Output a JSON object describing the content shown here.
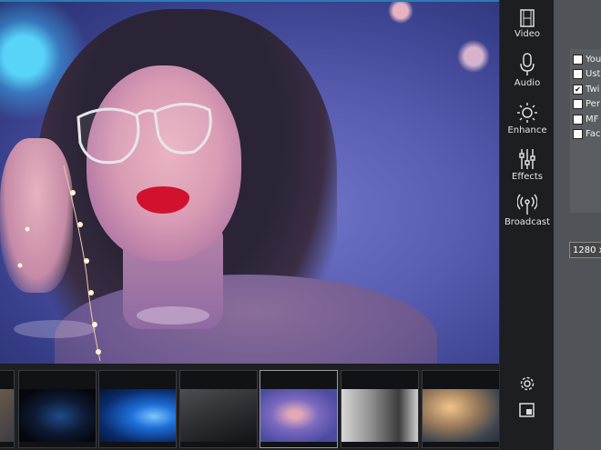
{
  "toolbar": {
    "items": [
      {
        "label": "Video",
        "icon": "film-icon"
      },
      {
        "label": "Audio",
        "icon": "microphone-icon"
      },
      {
        "label": "Enhance",
        "icon": "sun-icon"
      },
      {
        "label": "Effects",
        "icon": "sliders-icon"
      },
      {
        "label": "Broadcast",
        "icon": "broadcast-icon"
      }
    ],
    "bottom": [
      {
        "icon": "gear-icon"
      },
      {
        "icon": "picture-in-picture-icon"
      }
    ]
  },
  "panel": {
    "services": [
      {
        "label": "You",
        "checked": false
      },
      {
        "label": "Ust",
        "checked": false
      },
      {
        "label": "Twi",
        "checked": true
      },
      {
        "label": "Per",
        "checked": false
      },
      {
        "label": "MF",
        "checked": false
      },
      {
        "label": "Fac",
        "checked": false
      }
    ],
    "resolution": "1280 x"
  },
  "thumbnails": [
    {
      "name": "thumb-partial-left",
      "selected": false
    },
    {
      "name": "thumb-gamer-dark",
      "selected": false
    },
    {
      "name": "thumb-windows-desktop",
      "selected": false
    },
    {
      "name": "thumb-dark-room",
      "selected": false
    },
    {
      "name": "thumb-woman-glasses",
      "selected": true
    },
    {
      "name": "thumb-woman-headphones",
      "selected": false
    },
    {
      "name": "thumb-desk-setup",
      "selected": false
    }
  ],
  "colors": {
    "accent": "#2a7bb5",
    "panel": "#505357",
    "toolbar": "#1c1e22"
  }
}
